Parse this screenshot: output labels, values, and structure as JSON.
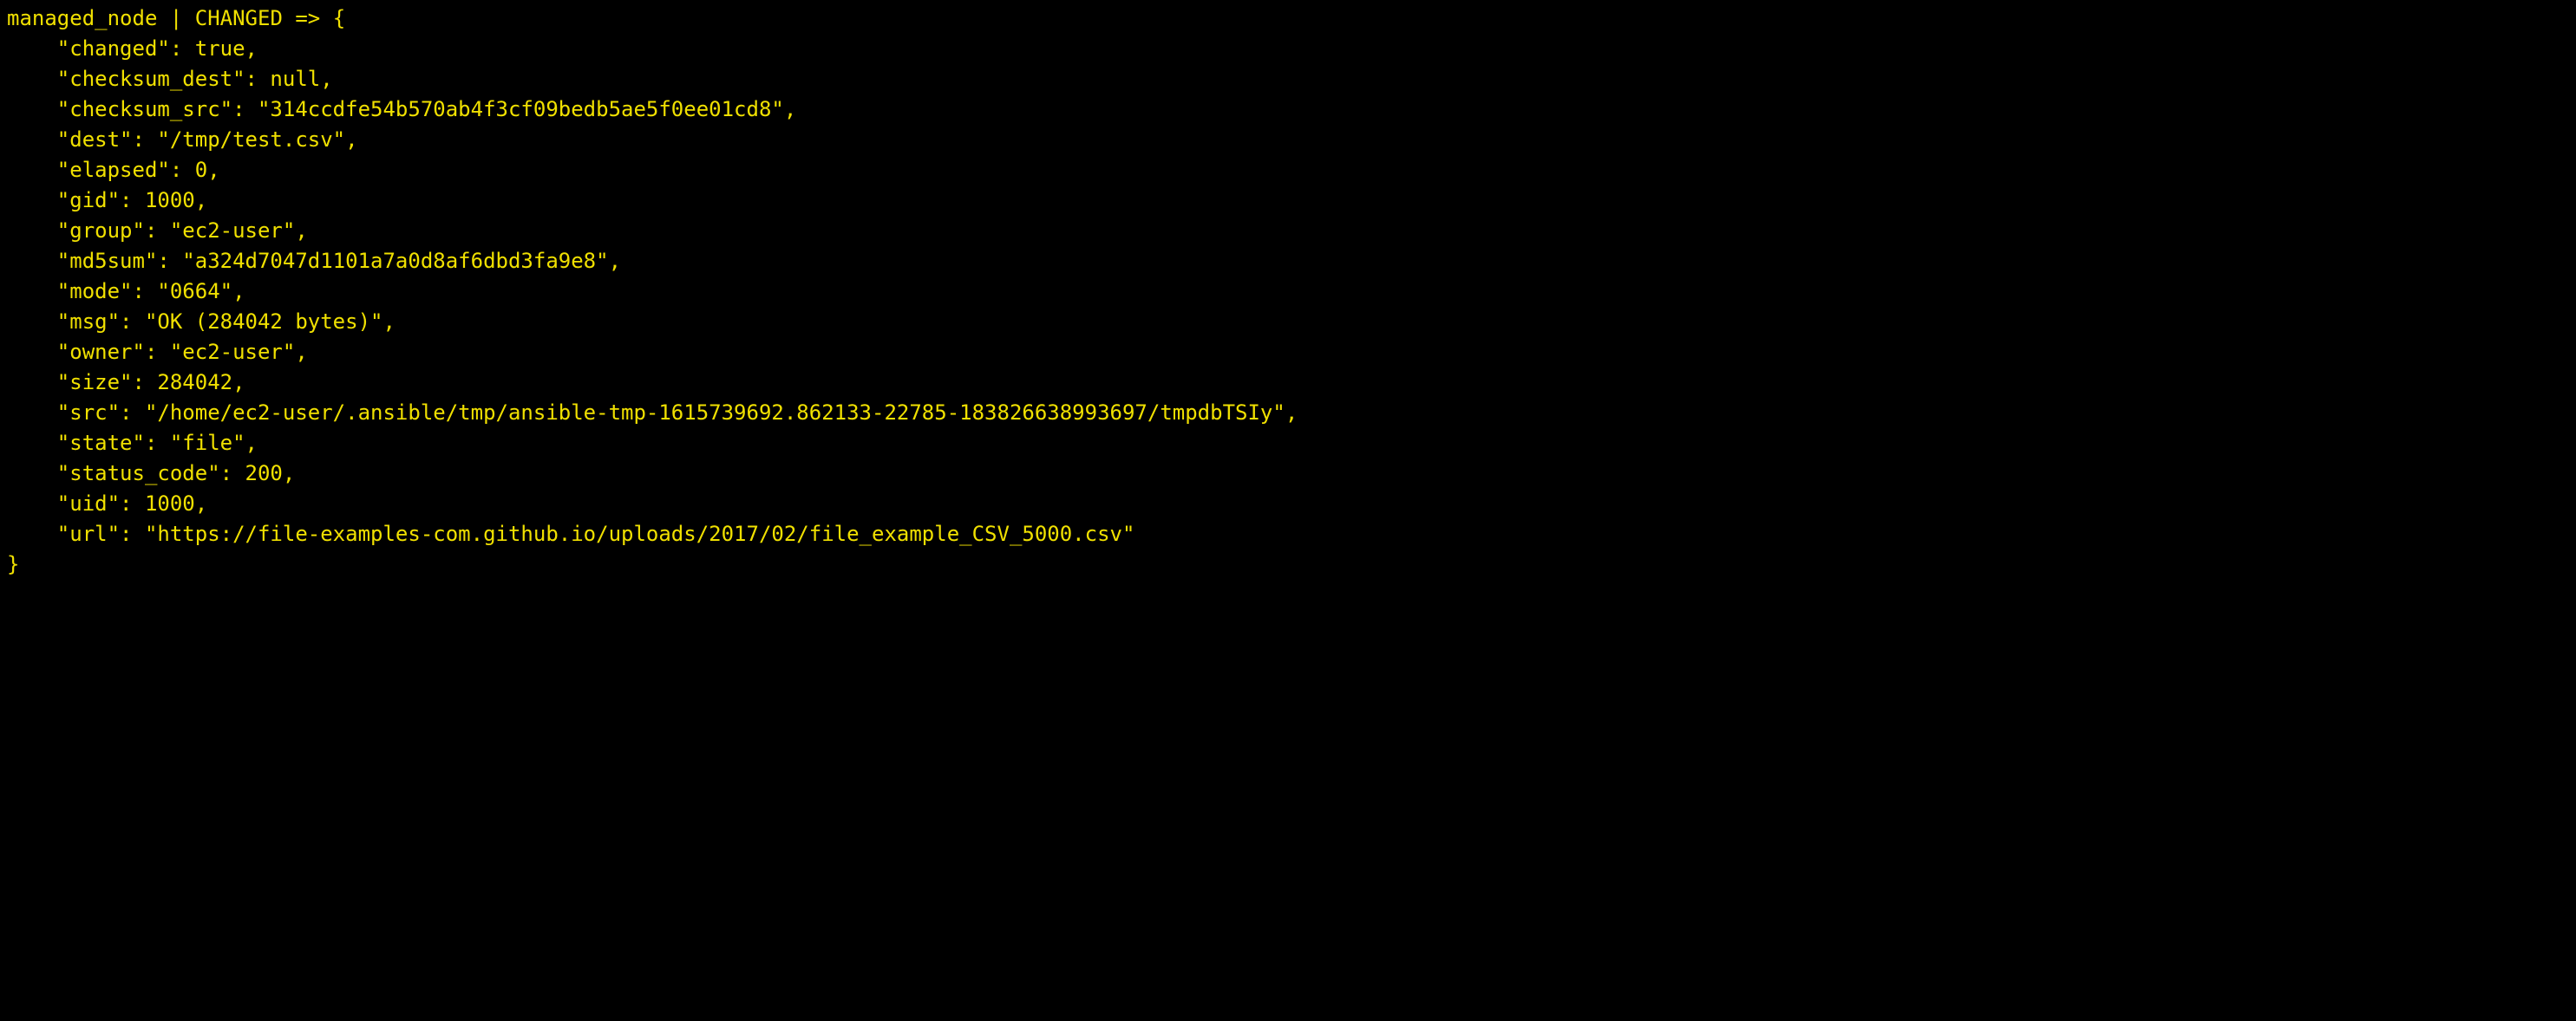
{
  "header": {
    "host": "managed_node",
    "sep": " | ",
    "status": "CHANGED",
    "arrow": " => {"
  },
  "lines": [
    {
      "key": "changed",
      "value": "true",
      "quoted": false,
      "comma": ","
    },
    {
      "key": "checksum_dest",
      "value": "null",
      "quoted": false,
      "comma": ","
    },
    {
      "key": "checksum_src",
      "value": "314ccdfe54b570ab4f3cf09bedb5ae5f0ee01cd8",
      "quoted": true,
      "comma": ","
    },
    {
      "key": "dest",
      "value": "/tmp/test.csv",
      "quoted": true,
      "comma": ","
    },
    {
      "key": "elapsed",
      "value": "0",
      "quoted": false,
      "comma": ","
    },
    {
      "key": "gid",
      "value": "1000",
      "quoted": false,
      "comma": ","
    },
    {
      "key": "group",
      "value": "ec2-user",
      "quoted": true,
      "comma": ","
    },
    {
      "key": "md5sum",
      "value": "a324d7047d1101a7a0d8af6dbd3fa9e8",
      "quoted": true,
      "comma": ","
    },
    {
      "key": "mode",
      "value": "0664",
      "quoted": true,
      "comma": ","
    },
    {
      "key": "msg",
      "value": "OK (284042 bytes)",
      "quoted": true,
      "comma": ","
    },
    {
      "key": "owner",
      "value": "ec2-user",
      "quoted": true,
      "comma": ","
    },
    {
      "key": "size",
      "value": "284042",
      "quoted": false,
      "comma": ","
    },
    {
      "key": "src",
      "value": "/home/ec2-user/.ansible/tmp/ansible-tmp-1615739692.862133-22785-183826638993697/tmpdbTSIy",
      "quoted": true,
      "comma": ","
    },
    {
      "key": "state",
      "value": "file",
      "quoted": true,
      "comma": ","
    },
    {
      "key": "status_code",
      "value": "200",
      "quoted": false,
      "comma": ","
    },
    {
      "key": "uid",
      "value": "1000",
      "quoted": false,
      "comma": ","
    },
    {
      "key": "url",
      "value": "https://file-examples-com.github.io/uploads/2017/02/file_example_CSV_5000.csv",
      "quoted": true,
      "comma": ""
    }
  ],
  "footer": "}"
}
